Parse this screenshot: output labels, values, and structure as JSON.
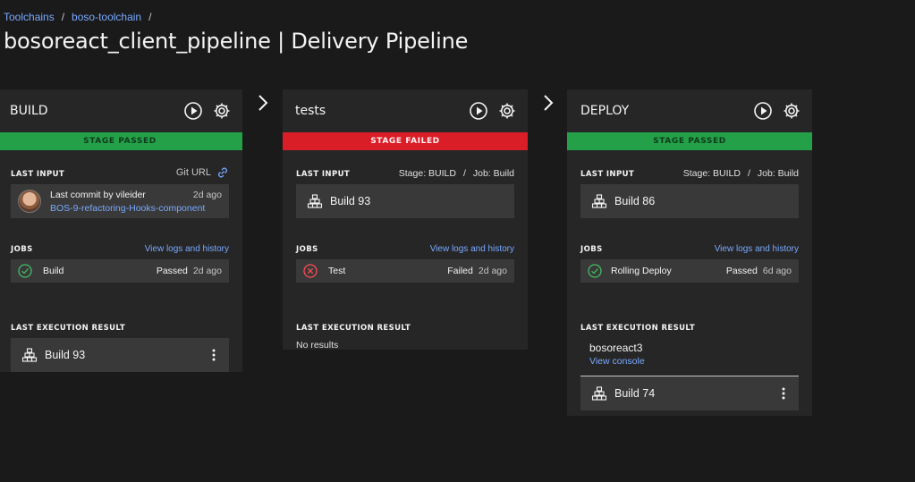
{
  "breadcrumb": {
    "items": [
      "Toolchains",
      "boso-toolchain"
    ],
    "separator": "/"
  },
  "page": {
    "title": "bosoreact_client_pipeline | Delivery Pipeline"
  },
  "labels": {
    "last_input": "LAST INPUT",
    "jobs": "JOBS",
    "last_execution_result": "LAST EXECUTION RESULT",
    "view_logs": "View logs and history"
  },
  "stages": [
    {
      "name": "BUILD",
      "status": "STAGE PASSED",
      "status_color": "#24a148",
      "input_source": "Git URL",
      "input": {
        "commit_by": "Last commit by vileider",
        "age": "2d ago",
        "message": "BOS-9-refactoring-Hooks-component"
      },
      "job": {
        "name": "Build",
        "status": "Passed",
        "age": "2d ago"
      },
      "result": {
        "build": "Build 93"
      }
    },
    {
      "name": "tests",
      "status": "STAGE FAILED",
      "status_color": "#da1e28",
      "input_stage": "Stage: BUILD",
      "input_job": "Job: Build",
      "input": {
        "build": "Build 93"
      },
      "job": {
        "name": "Test",
        "status": "Failed",
        "age": "2d ago"
      },
      "result": {
        "text": "No results"
      }
    },
    {
      "name": "DEPLOY",
      "status": "STAGE PASSED",
      "status_color": "#24a148",
      "input_stage": "Stage: BUILD",
      "input_job": "Job: Build",
      "input": {
        "build": "Build 86"
      },
      "job": {
        "name": "Rolling Deploy",
        "status": "Passed",
        "age": "6d ago"
      },
      "result": {
        "environment": "bosoreact3",
        "console_link": "View console",
        "build": "Build 74"
      }
    }
  ],
  "icons": {
    "run": "play-circle-icon",
    "settings": "gear-icon",
    "link": "link-icon",
    "passed": "check-circle-icon",
    "failed": "x-circle-icon",
    "build": "build-stack-icon",
    "overflow": "kebab-menu-icon",
    "next": "chevron-right-icon"
  }
}
